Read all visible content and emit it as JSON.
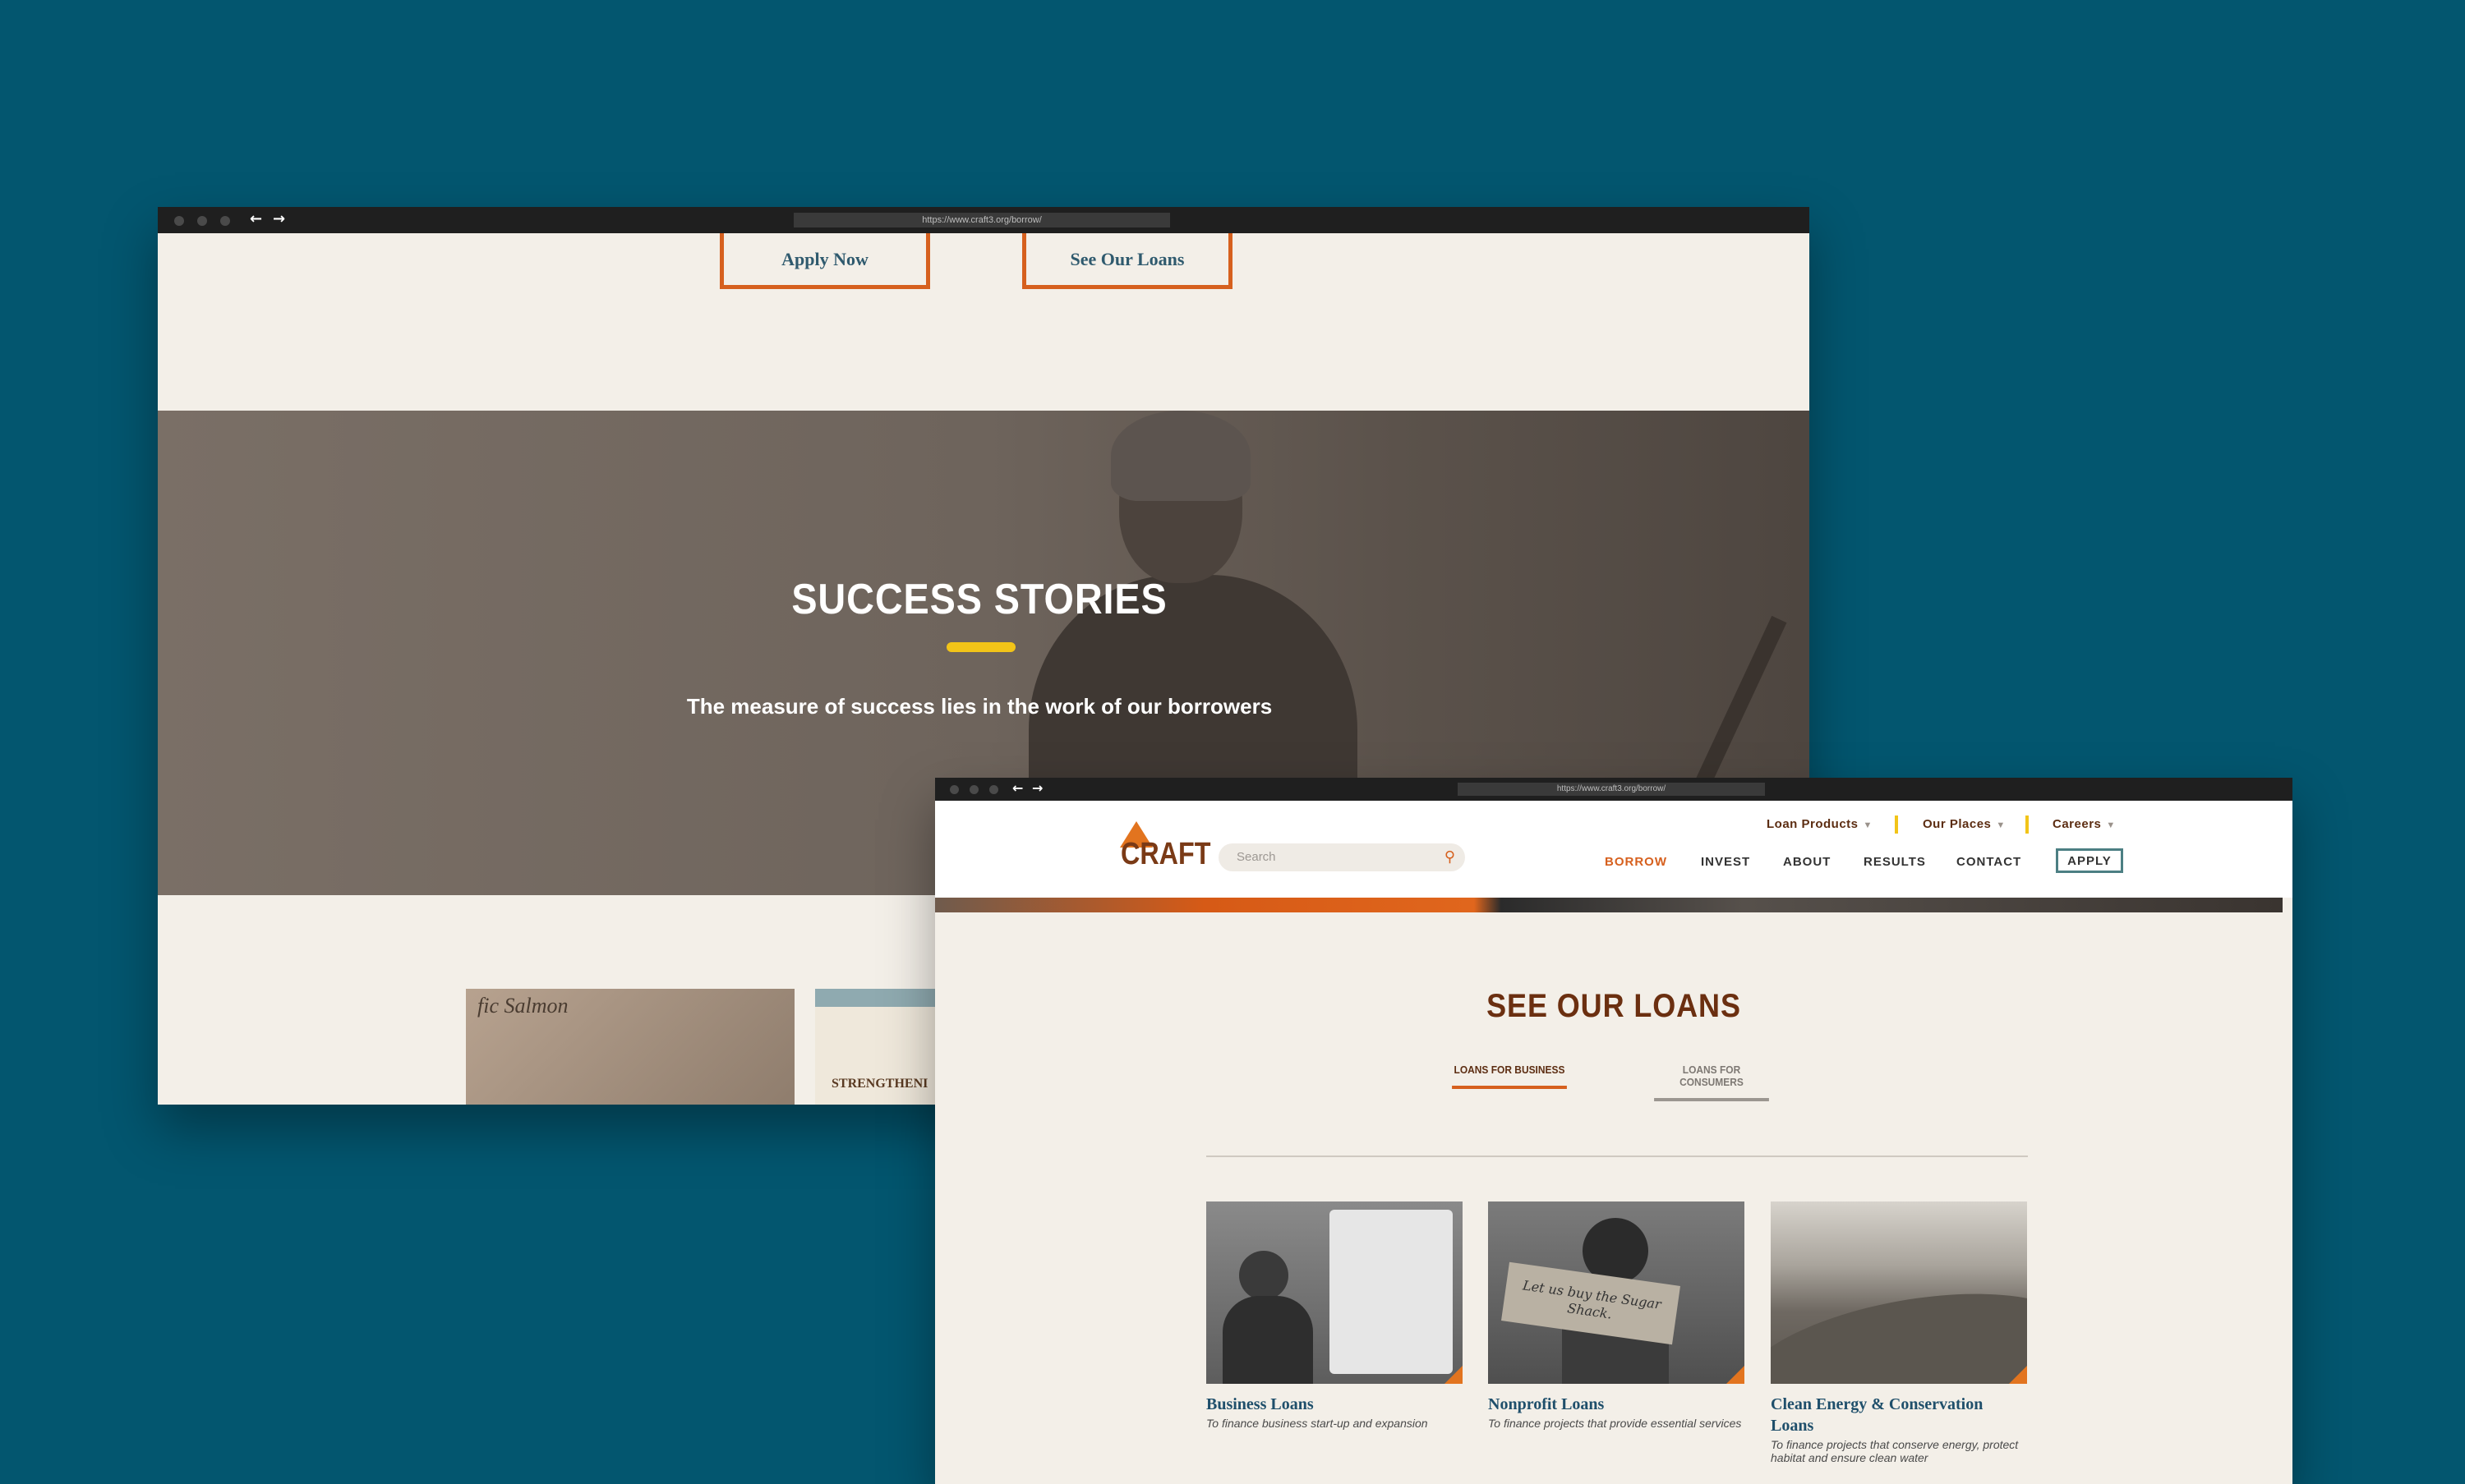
{
  "back_window": {
    "url": "https://www.craft3.org/borrow/",
    "buttons": {
      "apply": "Apply Now",
      "see_loans": "See Our Loans"
    },
    "hero": {
      "title": "SUCCESS STORIES",
      "subtitle": "The measure of success lies in the work of our borrowers"
    },
    "stories": {
      "thumb1_text": "fic Salmon",
      "thumb2_text": "STRENGTHENI"
    }
  },
  "front_window": {
    "url": "https://www.craft3.org/borrow/",
    "logo": "CRAFT",
    "search": {
      "placeholder": "Search"
    },
    "topnav": [
      {
        "label": "Loan Products"
      },
      {
        "label": "Our Places"
      },
      {
        "label": "Careers"
      }
    ],
    "mainnav": {
      "borrow": "BORROW",
      "invest": "INVEST",
      "about": "ABOUT",
      "results": "RESULTS",
      "contact": "CONTACT",
      "apply": "APPLY"
    },
    "section_title": "SEE OUR LOANS",
    "tabs": {
      "business": "LOANS FOR BUSINESS",
      "consumers": "LOANS FOR CONSUMERS"
    },
    "cards": [
      {
        "title": "Business Loans",
        "desc": "To finance business start-up and expansion"
      },
      {
        "title": "Nonprofit Loans",
        "desc": "To finance projects that provide essential services"
      },
      {
        "title": "Clean Energy & Conservation Loans",
        "desc": "To finance projects that conserve energy, protect habitat and ensure clean water"
      }
    ],
    "sign_text": "Let us buy the Sugar Shack."
  },
  "colors": {
    "background": "#03566f",
    "accent_orange": "#d6601e",
    "accent_yellow": "#f2c418",
    "brown": "#6b2f10",
    "link_blue": "#1f4f6b"
  }
}
